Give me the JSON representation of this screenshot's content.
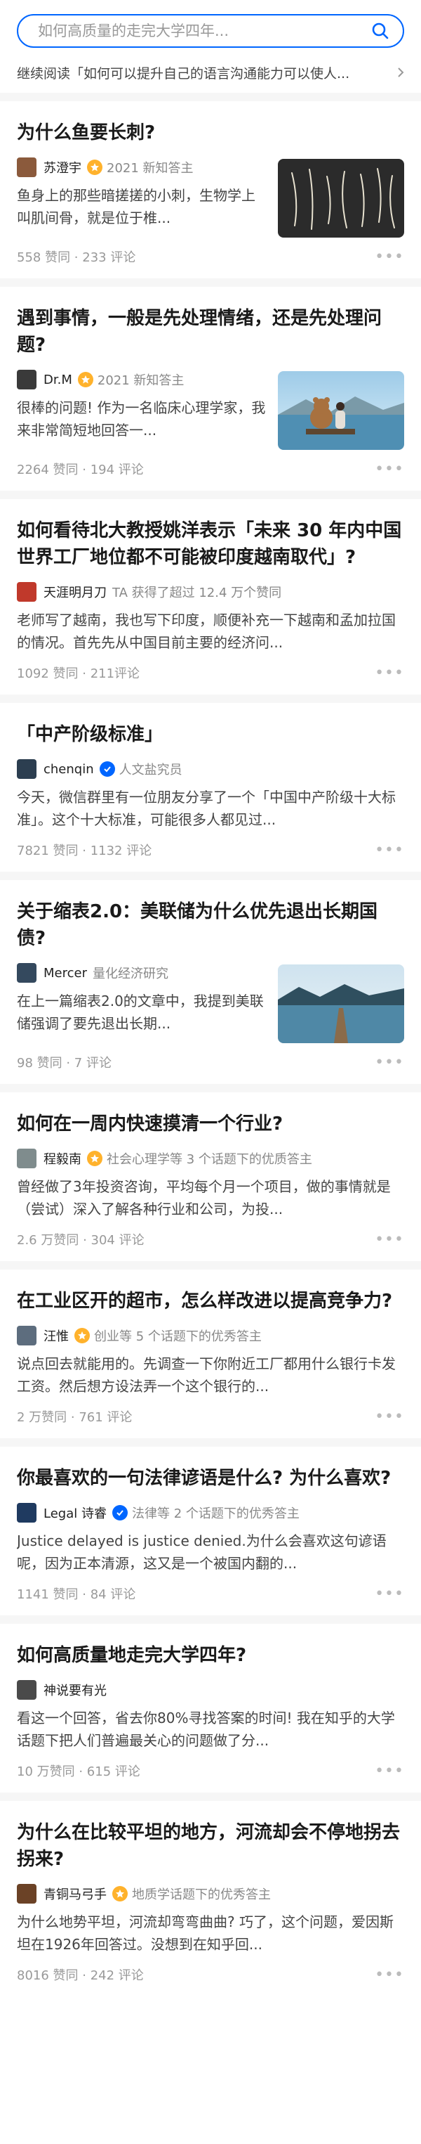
{
  "search": {
    "placeholder": "如何高质量的走完大学四年..."
  },
  "continue_reading": {
    "text": "继续阅读「如何可以提升自己的语言沟通能力可以使人..."
  },
  "cards": [
    {
      "title": "为什么鱼要长刺?",
      "author": "苏澄宇",
      "badge": "gold",
      "meta": "2021 新知答主",
      "excerpt": "鱼身上的那些暗搓搓的小刺，生物学上叫肌间骨，就是位于椎...",
      "stats": "558 赞同 · 233 评论",
      "thumb": "fishbones",
      "avatar_color": "#8b5a3c"
    },
    {
      "title": "遇到事情，一般是先处理情绪，还是先处理问题?",
      "author": "Dr.M",
      "badge": "gold",
      "meta": "2021 新知答主",
      "excerpt": "很棒的问题! 作为一名临床心理学家，我来非常简短地回答一...",
      "stats": "2264 赞同 · 194 评论",
      "thumb": "bear",
      "avatar_color": "#3a3a3a"
    },
    {
      "title": "如何看待北大教授姚洋表示「未来 30 年内中国世界工厂地位都不可能被印度越南取代」?",
      "author": "天涯明月刀",
      "badge": "",
      "meta": "TA 获得了超过 12.4 万个赞同",
      "excerpt": "老师写了越南，我也写下印度，顺便补充一下越南和孟加拉国的情况。首先先从中国目前主要的经济问...",
      "stats": "1092 赞同 · 211评论",
      "thumb": "",
      "avatar_color": "#c0392b"
    },
    {
      "title": "「中产阶级标准」",
      "author": "chenqin",
      "badge": "blue",
      "meta": "人文盐究员",
      "excerpt": "今天，微信群里有一位朋友分享了一个「中国中产阶级十大标准」。这个十大标准，可能很多人都见过...",
      "stats": "7821 赞同 · 1132 评论",
      "thumb": "",
      "avatar_color": "#2c3e50"
    },
    {
      "title": "关于缩表2.0：美联储为什么优先退出长期国债?",
      "author": "Mercer",
      "badge": "",
      "meta": "量化经济研究",
      "excerpt": "在上一篇缩表2.0的文章中，我提到美联储强调了要先退出长期...",
      "stats": "98 赞同 · 7 评论",
      "thumb": "lake",
      "avatar_color": "#34495e"
    },
    {
      "title": "如何在一周内快速摸清一个行业?",
      "author": "程毅南",
      "badge": "gold",
      "meta": "社会心理学等 3 个话题下的优质答主",
      "excerpt": "曾经做了3年投资咨询，平均每个月一个项目，做的事情就是（尝试）深入了解各种行业和公司，为投...",
      "stats": "2.6 万赞同 · 304 评论",
      "thumb": "",
      "avatar_color": "#7f8c8d"
    },
    {
      "title": "在工业区开的超市，怎么样改进以提高竞争力?",
      "author": "汪惟",
      "badge": "gold",
      "meta": "创业等 5 个话题下的优秀答主",
      "excerpt": "说点回去就能用的。先调查一下你附近工厂都用什么银行卡发工资。然后想方设法弄一个这个银行的...",
      "stats": "2 万赞同 · 761 评论",
      "thumb": "",
      "avatar_color": "#5d6d7e"
    },
    {
      "title": "你最喜欢的一句法律谚语是什么? 为什么喜欢?",
      "author": "Legal 诗睿",
      "badge": "blue",
      "meta": "法律等 2 个话题下的优秀答主",
      "excerpt": "Justice delayed is justice denied.为什么会喜欢这句谚语呢，因为正本清源，这又是一个被国内翻的...",
      "stats": "1141 赞同 · 84 评论",
      "thumb": "",
      "avatar_color": "#1f3a60"
    },
    {
      "title": "如何高质量地走完大学四年?",
      "author": "神说要有光",
      "badge": "",
      "meta": "",
      "excerpt": "看这一个回答，省去你80%寻找答案的时间! 我在知乎的大学话题下把人们普遍最关心的问题做了分...",
      "stats": "10 万赞同 · 615 评论",
      "thumb": "",
      "avatar_color": "#4a4a4a"
    },
    {
      "title": "为什么在比较平坦的地方，河流却会不停地拐去拐来?",
      "author": "青铜马弓手",
      "badge": "gold",
      "meta": "地质学话题下的优秀答主",
      "excerpt": "为什么地势平坦，河流却弯弯曲曲? 巧了，这个问题，爱因斯坦在1926年回答过。没想到在知乎回...",
      "stats": "8016 赞同 · 242 评论",
      "thumb": "",
      "avatar_color": "#6b4226"
    }
  ]
}
